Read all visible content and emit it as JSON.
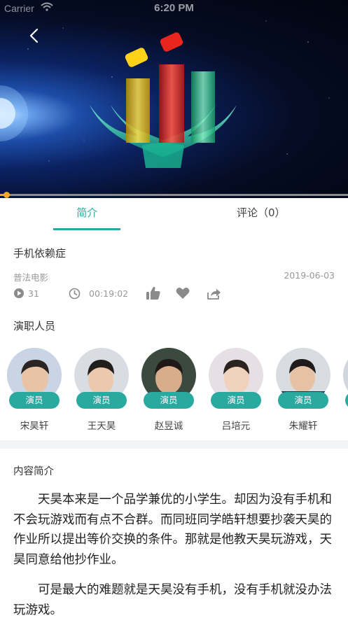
{
  "status_bar": {
    "carrier": "Carrier",
    "time": "6:20 PM"
  },
  "player": {
    "progress": 0.01
  },
  "tabs": [
    {
      "label": "简介",
      "active": true
    },
    {
      "label": "评论（0）",
      "active": false
    }
  ],
  "video": {
    "title": "手机依赖症",
    "source": "普法电影",
    "date": "2019-06-03",
    "play_count": "31",
    "duration": "00:19:02"
  },
  "cast": {
    "heading": "演职人员",
    "members": [
      {
        "role": "演员",
        "name": "宋昊轩"
      },
      {
        "role": "演员",
        "name": "王天昊"
      },
      {
        "role": "演员",
        "name": "赵昱诚"
      },
      {
        "role": "演员",
        "name": "吕培元"
      },
      {
        "role": "演员",
        "name": "朱耀轩"
      },
      {
        "role": "演员",
        "name": ""
      }
    ]
  },
  "summary": {
    "heading": "内容简介",
    "paragraphs": [
      "天昊本来是一个品学兼优的小学生。却因为没有手机和不会玩游戏而有点不合群。而同班同学皓轩想要抄袭天昊的作业所以提出等价交换的条件。那就是他教天昊玩游戏，天昊同意给他抄作业。",
      "可是最大的难题就是天昊没有手机，没有手机就没办法玩游戏。"
    ]
  },
  "colors": {
    "accent": "#2aa9a0",
    "progress": "#f5a623"
  }
}
